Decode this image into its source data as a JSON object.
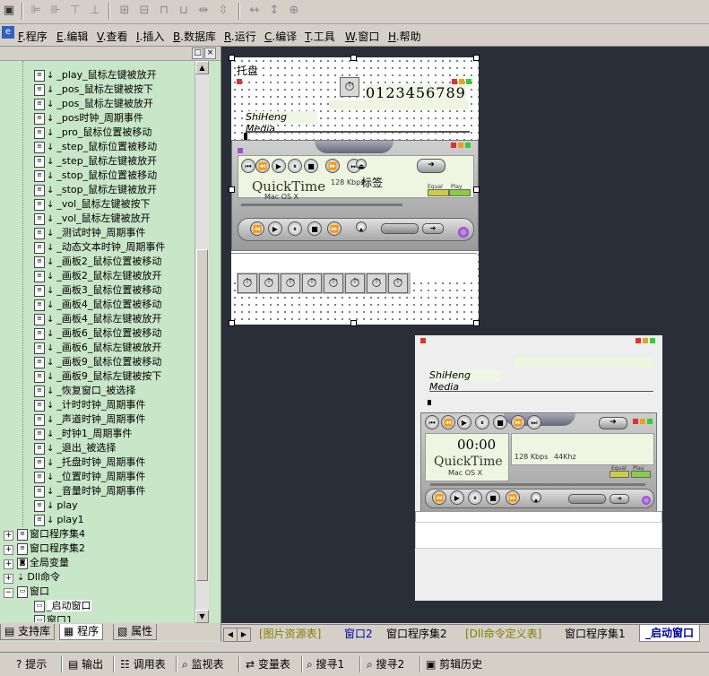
{
  "menu": {
    "items": [
      {
        "key": "F",
        "rest": ".程序"
      },
      {
        "key": "E",
        "rest": ".编辑"
      },
      {
        "key": "V",
        "rest": ".查看"
      },
      {
        "key": "I",
        "rest": ".插入"
      },
      {
        "key": "B",
        "rest": ".数据库"
      },
      {
        "key": "R",
        "rest": ".运行"
      },
      {
        "key": "C",
        "rest": ".编译"
      },
      {
        "key": "T",
        "rest": ".工具"
      },
      {
        "key": "W",
        "rest": ".窗口"
      },
      {
        "key": "H",
        "rest": ".帮助"
      }
    ]
  },
  "tree": {
    "events": [
      "_play_鼠标左键被放开",
      "_pos_鼠标左键被按下",
      "_pos_鼠标左键被放开",
      "_pos时钟_周期事件",
      "_pro_鼠标位置被移动",
      "_step_鼠标位置被移动",
      "_step_鼠标左键被放开",
      "_stop_鼠标位置被移动",
      "_stop_鼠标左键被放开",
      "_vol_鼠标左键被按下",
      "_vol_鼠标左键被放开",
      "_测试时钟_周期事件",
      "_动态文本时钟_周期事件",
      "_画板2_鼠标位置被移动",
      "_画板2_鼠标左键被放开",
      "_画板3_鼠标位置被移动",
      "_画板4_鼠标位置被移动",
      "_画板4_鼠标左键被放开",
      "_画板6_鼠标位置被移动",
      "_画板6_鼠标左键被放开",
      "_画板9_鼠标位置被移动",
      "_画板9_鼠标左键被按下",
      "_恢复窗口_被选择",
      "_计时时钟_周期事件",
      "_声道时钟_周期事件",
      "_时钟1_周期事件",
      "_退出_被选择",
      "_托盘时钟_周期事件",
      "_位置时钟_周期事件",
      "_音量时钟_周期事件",
      "play",
      "play1"
    ],
    "groups": [
      "窗口程序集4",
      "窗口程序集2",
      "全局变量",
      "Dll命令",
      "窗口"
    ],
    "windows": [
      "_启动窗口",
      "窗口1"
    ]
  },
  "left_tabs": [
    "支持库",
    "程序",
    "属性"
  ],
  "design": {
    "tray_label": "托盘",
    "counter_text": "0123456789",
    "brand_text": "ShiHeng Media",
    "quicktime": "QuickTime",
    "macos": "Mac OS X",
    "bitrate": "128 Kbps",
    "freq": "44Khz",
    "label_text": "标签",
    "time_text": "00:00",
    "equal": "Equal",
    "play": "Play",
    "timer_count": 8
  },
  "doc_tabs": [
    "[图片资源表]",
    "窗口2",
    "窗口程序集2",
    "[Dll命令定义表]",
    "窗口程序集1",
    "_启动窗口"
  ],
  "bottom_tools": [
    "提示",
    "输出",
    "调用表",
    "监视表",
    "变量表",
    "搜寻1",
    "搜寻2",
    "剪辑历史"
  ]
}
